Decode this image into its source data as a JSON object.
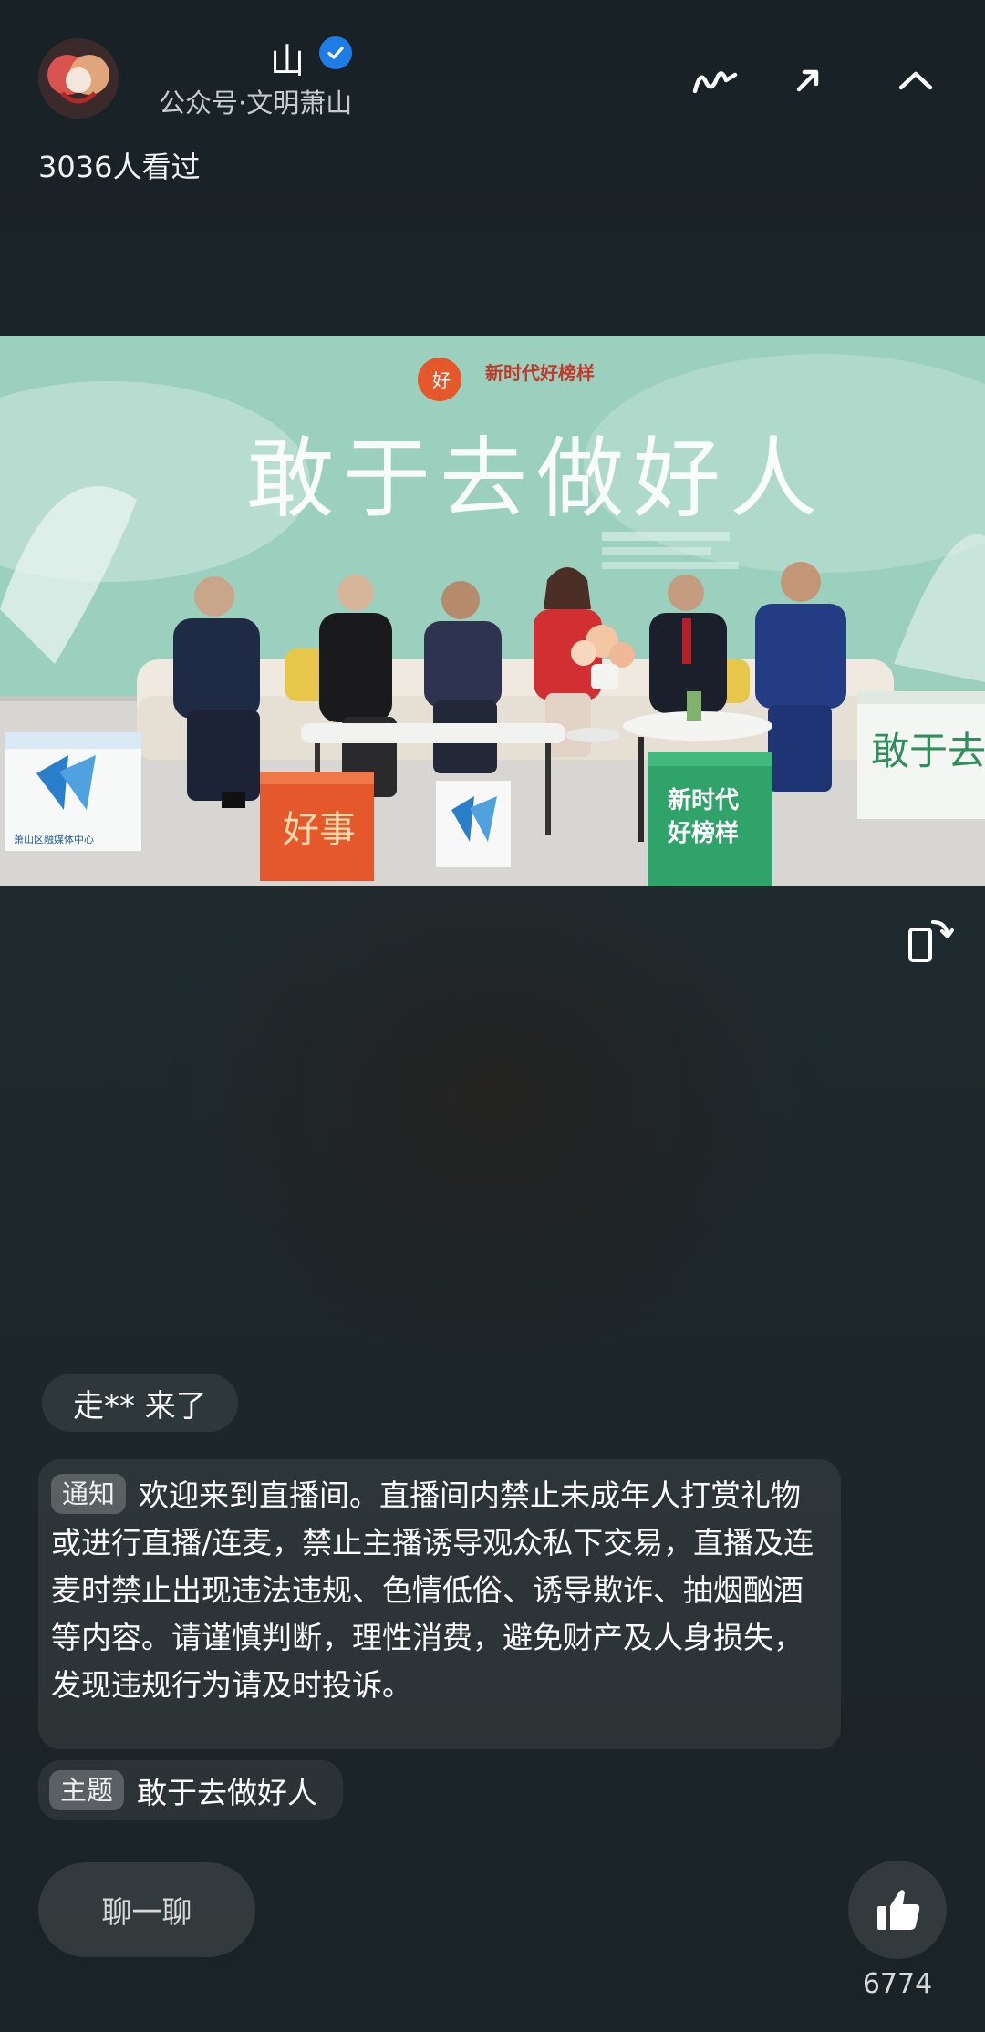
{
  "header": {
    "channel_name": "山",
    "channel_sub": "公众号·文明萧山",
    "view_count": "3036人看过",
    "icons": [
      "squiggle-icon",
      "share-arrow-icon",
      "collapse-chevron-icon"
    ]
  },
  "video": {
    "banner_badge": "新时代好榜样",
    "banner_calligraphy": "敢于去做好人",
    "box_green_text_line1": "新时代",
    "box_green_text_line2": "好榜样",
    "box_right_calligraphy": "敢于去做好人",
    "box_left_label": "萧山区融媒体中心"
  },
  "chat": {
    "join_message": "走** 来了",
    "notice_tag": "通知",
    "notice_text": "欢迎来到直播间。直播间内禁止未成年人打赏礼物或进行直播/连麦，禁止主播诱导观众私下交易，直播及连麦时禁止出现违法违规、色情低俗、诱导欺诈、抽烟酗酒等内容。请谨慎判断，理性消费，避免财产及人身损失，发现违规行为请及时投诉。",
    "topic_tag": "主题",
    "topic_text": "敢于去做好人"
  },
  "bottom": {
    "chat_button_label": "聊一聊",
    "like_count": "6774"
  },
  "colors": {
    "background": "#1d2629",
    "verified_badge": "#1e7ce6",
    "banner_green": "#8fc7b6",
    "cube_orange": "#e5582b",
    "cube_green": "#2fa36a"
  }
}
